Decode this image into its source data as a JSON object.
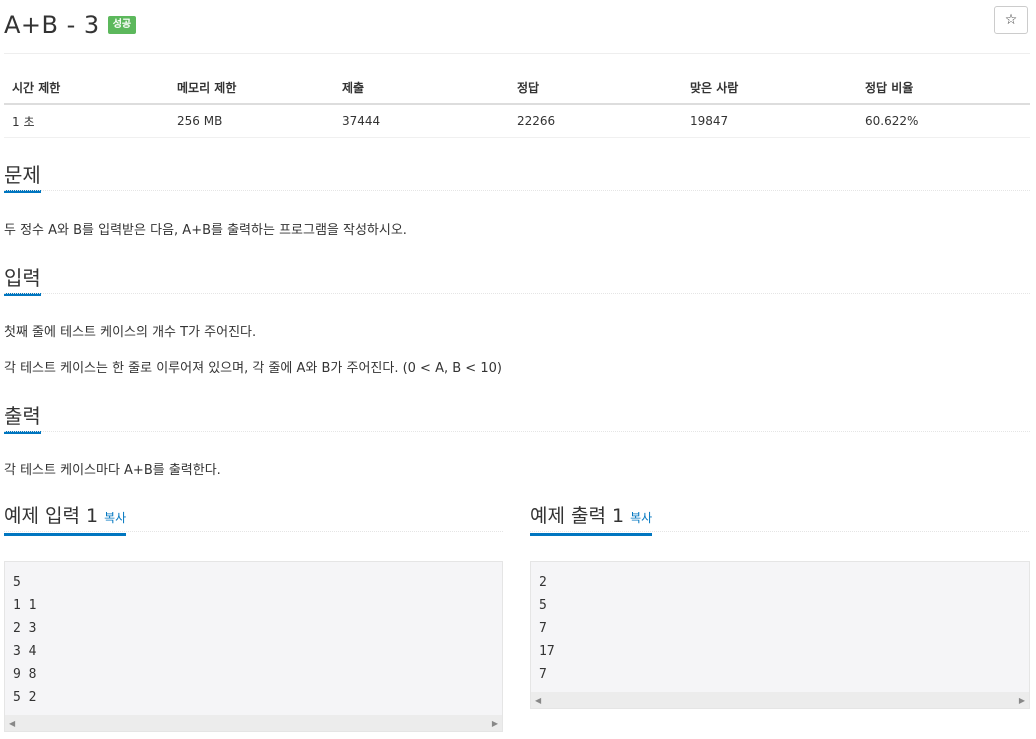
{
  "header": {
    "title": "A+B - 3",
    "badge": "성공",
    "star_icon": "★-outline"
  },
  "info_table": {
    "headers": [
      "시간 제한",
      "메모리 제한",
      "제출",
      "정답",
      "맞은 사람",
      "정답 비율"
    ],
    "values": [
      "1 초",
      "256 MB",
      "37444",
      "22266",
      "19847",
      "60.622%"
    ]
  },
  "problem": {
    "heading": "문제",
    "text": "두 정수 A와 B를 입력받은 다음, A+B를 출력하는 프로그램을 작성하시오."
  },
  "input": {
    "heading": "입력",
    "lines": [
      "첫째 줄에 테스트 케이스의 개수 T가 주어진다.",
      "각 테스트 케이스는 한 줄로 이루어져 있으며, 각 줄에 A와 B가 주어진다. (0 < A, B < 10)"
    ]
  },
  "output": {
    "heading": "출력",
    "text": "각 테스트 케이스마다 A+B를 출력한다."
  },
  "sample_input": {
    "heading": "예제 입력 1",
    "copy_label": "복사",
    "lines": [
      "5",
      "1 1",
      "2 3",
      "3 4",
      "9 8",
      "5 2"
    ]
  },
  "sample_output": {
    "heading": "예제 출력 1",
    "copy_label": "복사",
    "lines": [
      "2",
      "5",
      "7",
      "17",
      "7"
    ]
  },
  "colors": {
    "accent": "#0076c0",
    "badge": "#5cb85c",
    "code_bg": "#f5f5f7"
  }
}
